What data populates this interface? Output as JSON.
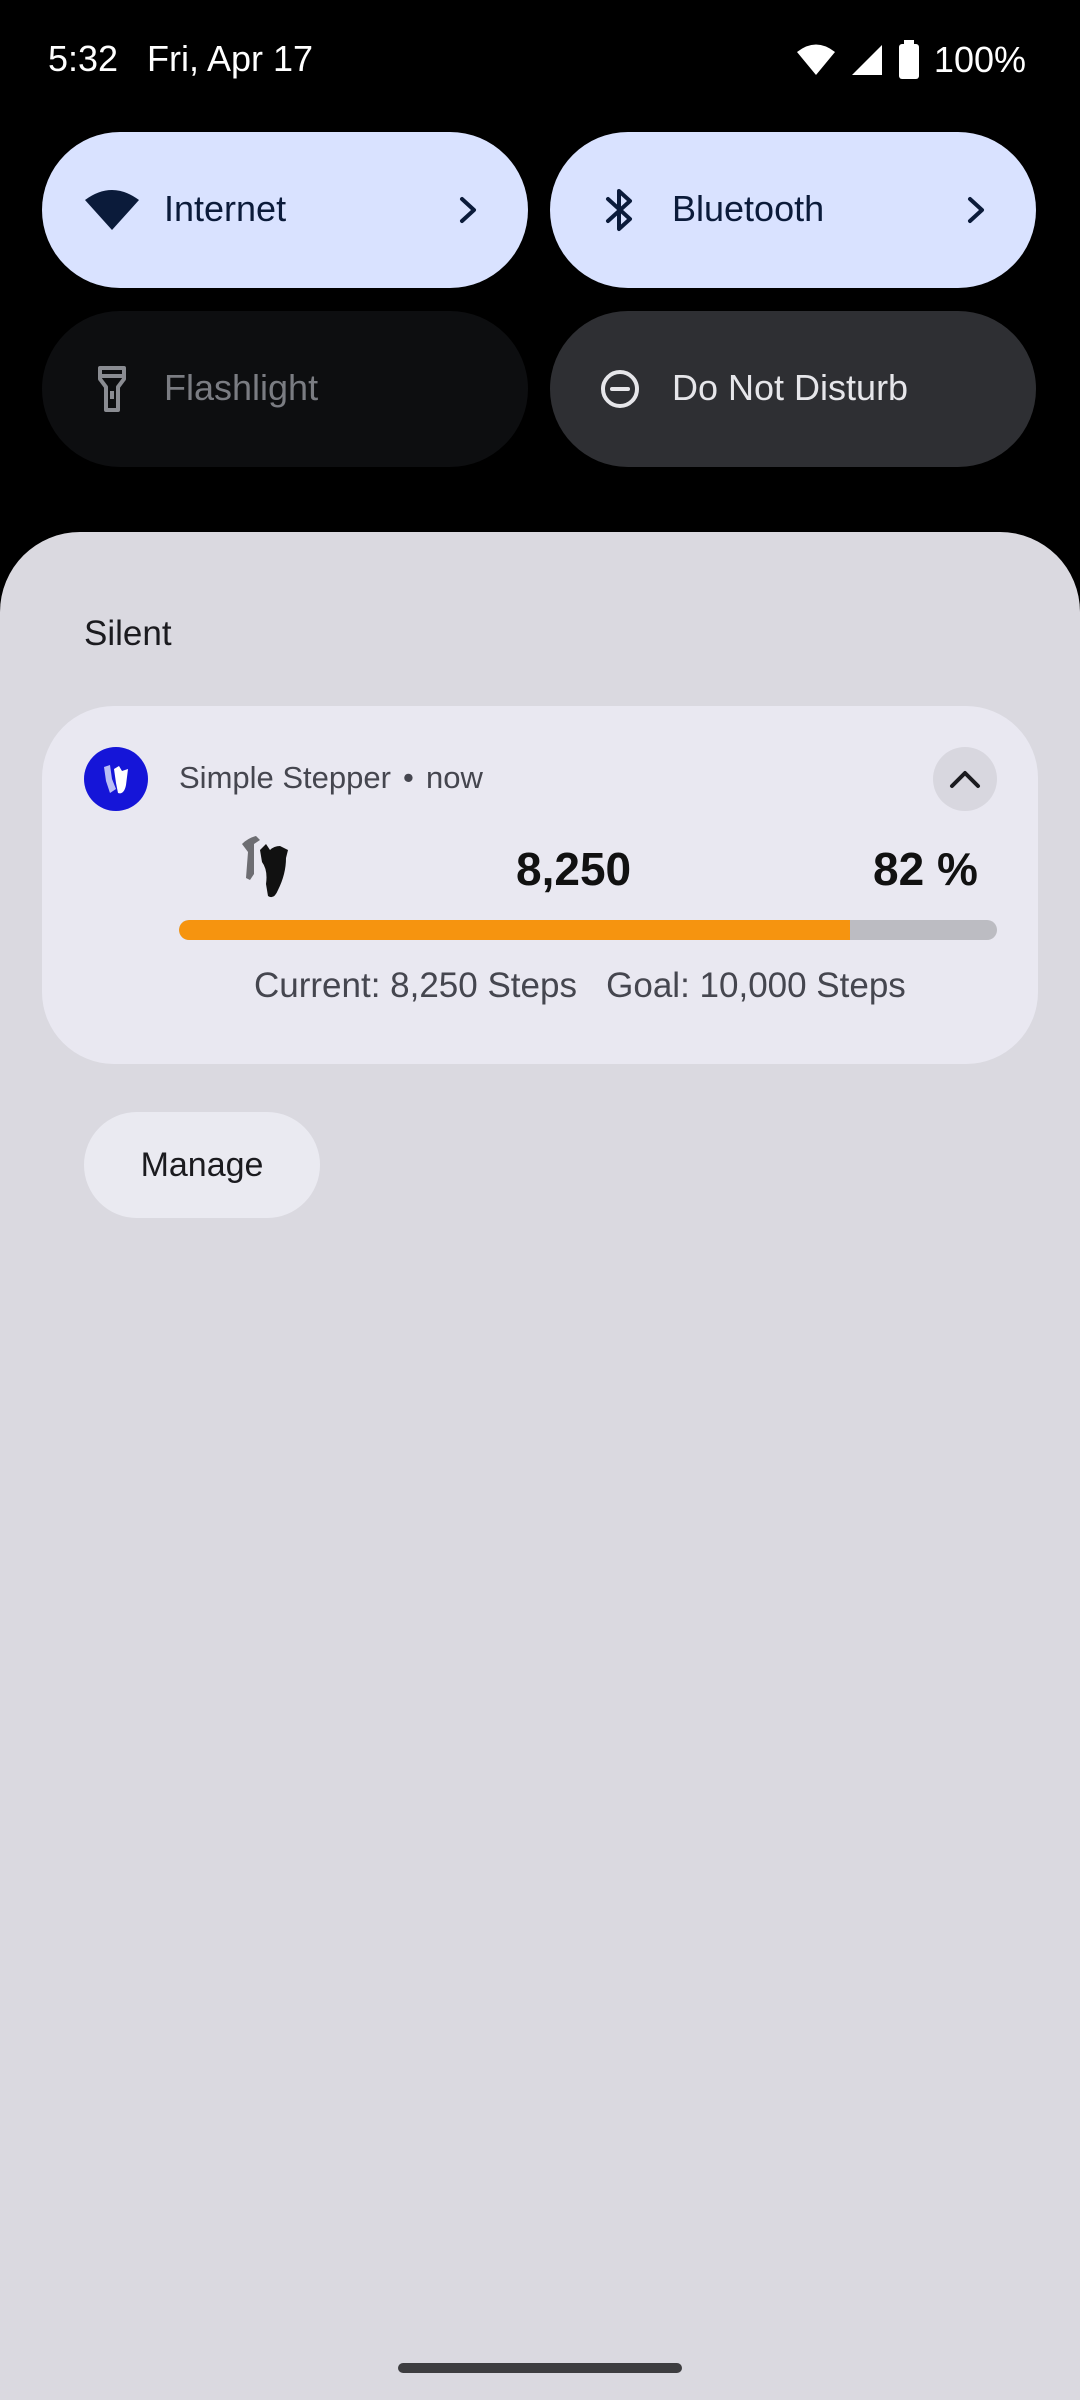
{
  "status_bar": {
    "time": "5:32",
    "date": "Fri, Apr 17",
    "battery_percent": "100%",
    "icons": [
      "wifi-icon",
      "cell-signal-icon",
      "battery-icon"
    ]
  },
  "quick_settings": {
    "tiles": [
      {
        "label": "Internet",
        "icon": "wifi-icon",
        "state": "on",
        "has_chevron": true
      },
      {
        "label": "Bluetooth",
        "icon": "bluetooth-icon",
        "state": "on",
        "has_chevron": true
      },
      {
        "label": "Flashlight",
        "icon": "flashlight-icon",
        "state": "off"
      },
      {
        "label": "Do Not Disturb",
        "icon": "do-not-disturb-icon",
        "state": "off"
      }
    ]
  },
  "notifications": {
    "section_label": "Silent",
    "card": {
      "app_name": "Simple Stepper",
      "separator": "•",
      "time": "now",
      "steps_display": "8,250",
      "percent_display": "82 %",
      "progress_fraction": 0.82,
      "current_text": "Current: 8,250 Steps",
      "goal_text": "Goal: 10,000 Steps"
    },
    "manage_label": "Manage"
  },
  "colors": {
    "accent_progress": "#f6940f",
    "tile_on": "#d9e2ff",
    "app_icon_bg": "#1515d8",
    "shade_bg": "#dad9e0"
  }
}
